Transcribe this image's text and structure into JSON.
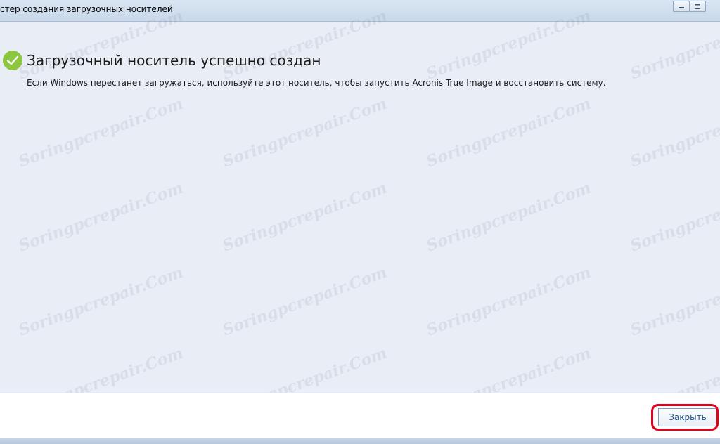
{
  "window": {
    "title": "стер создания загрузочных носителей"
  },
  "main": {
    "heading": "Загрузочный носитель успешно создан",
    "description": "Если Windows перестанет загружаться, используйте этот носитель, чтобы запустить Acronis True Image и восстановить систему."
  },
  "footer": {
    "close_label": "Закрыть"
  },
  "watermark": {
    "text": "Soringpcrepair.Com"
  },
  "icons": {
    "success": "checkmark-icon",
    "minimize": "minimize-icon",
    "maximize": "maximize-icon"
  },
  "colors": {
    "success_green": "#8dc63f",
    "content_bg": "#e9edf5",
    "highlight_red": "#e3001b",
    "button_text": "#1f4e8a"
  }
}
